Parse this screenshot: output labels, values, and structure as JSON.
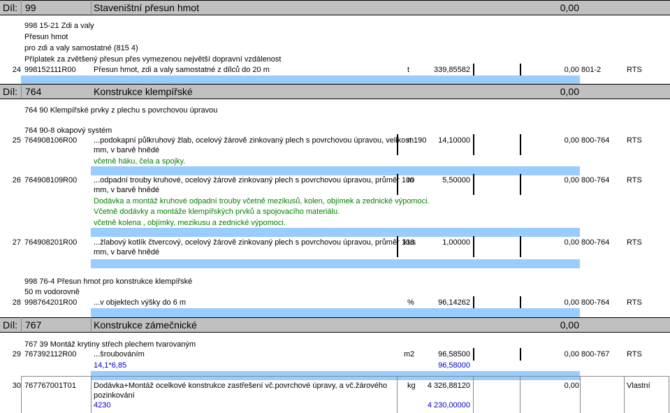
{
  "sections": {
    "s99": {
      "dil": "Díl:",
      "num": "99",
      "name": "Staveništní přesun hmot",
      "total": "0,00"
    },
    "s764": {
      "dil": "Díl:",
      "num": "764",
      "name": "Konstrukce klempířské",
      "total": "0,00"
    },
    "s767": {
      "dil": "Díl:",
      "num": "767",
      "name": "Konstrukce zámečnické",
      "total": "0,00"
    }
  },
  "notes": {
    "n1": "998 15-21 Zdi a valy",
    "n2": "Přesun hmot",
    "n3": "pro zdi a valy samostatné (815 4)",
    "n4": "Příplatek za zvětšený přesun přes vymezenou největší dopravní vzdálenost",
    "n5": "764 90 Klempířské prvky z plechu s povrchovou úpravou",
    "n6": "764 90-8 okapový systém",
    "n7": "998 76-4 Přesun hmot pro konstrukce klempířské",
    "n8": "50 m vodorovně",
    "n9": "767 39 Montáž krytiny střech plechem tvarovaným"
  },
  "rows": {
    "r24": {
      "no": "24",
      "code": "998152111R00",
      "desc": "Přesun hmot, zdi a valy samostatné z dílců do 20 m",
      "unit": "t",
      "qty": "339,85582",
      "total": "0,00",
      "cat": "801-2",
      "src": "RTS"
    },
    "r25": {
      "no": "25",
      "code": "764908106R00",
      "desc1": "...podokapní půlkruhový žlab, ocelový žárově zinkovaný plech s povrchovou úpravou, velikost 190",
      "desc2": "mm, v barvě hnědé",
      "note1": "včetně háku, čela a spojky.",
      "unit": "m",
      "qty": "14,10000",
      "total": "0,00",
      "cat": "800-764",
      "src": "RTS"
    },
    "r26": {
      "no": "26",
      "code": "764908109R00",
      "desc1": "...odpadní trouby kruhové, ocelový žárově zinkovaný plech s povrchovou úpravou, průměr 100",
      "desc2": "mm, v barvě hnědé",
      "note1": "Dodávka a montáž kruhové odpadní trouby včetně mezikusů, kolen, objímek a zednické výpomoci.",
      "note2": "Včetně dodávky a montáže klempířských prvků a spojovacího materiálu.",
      "note3": "včetně kolena , objímky, mezikusu a zednické výpomoci.",
      "unit": "m",
      "qty": "5,50000",
      "total": "0,00",
      "cat": "800-764",
      "src": "RTS"
    },
    "r27": {
      "no": "27",
      "code": "764908201R00",
      "desc1": "...žlabový kotlík čtvercový, ocelový žárově zinkovaný plech s povrchovou úpravou, průměr 136",
      "desc2": "mm, v barvě hnědé",
      "unit": "kus",
      "qty": "1,00000",
      "total": "0,00",
      "cat": "800-764",
      "src": "RTS"
    },
    "r28": {
      "no": "28",
      "code": "998764201R00",
      "desc": "...v objektech výšky do 6 m",
      "unit": "%",
      "qty": "96,14262",
      "total": "0,00",
      "cat": "800-764",
      "src": "RTS"
    },
    "r29": {
      "no": "29",
      "code": "767392112R00",
      "desc": "...šroubováním",
      "unit": "m2",
      "qty": "96,58500",
      "total": "0,00",
      "cat": "800-767",
      "src": "RTS",
      "calc": "14,1*6,85",
      "calc_val": "96,58000"
    },
    "r30": {
      "no": "30",
      "code": "767767001T01",
      "desc1": "Dodávka+Montáž ocelkové konstrukce zastřešení vč.povrchové úpravy, a vč.žárového",
      "desc2": "pozinkování",
      "unit": "kg",
      "qty": "4 326,88120",
      "total": "0,00",
      "src": "Vlastní",
      "calc": "4230",
      "calc_val": "4 230,00000"
    }
  },
  "colors": {
    "header_bg": "#c0c0c0",
    "strip_bg": "#99ccff",
    "note_green": "#008000",
    "calc_blue": "#0000cc"
  }
}
